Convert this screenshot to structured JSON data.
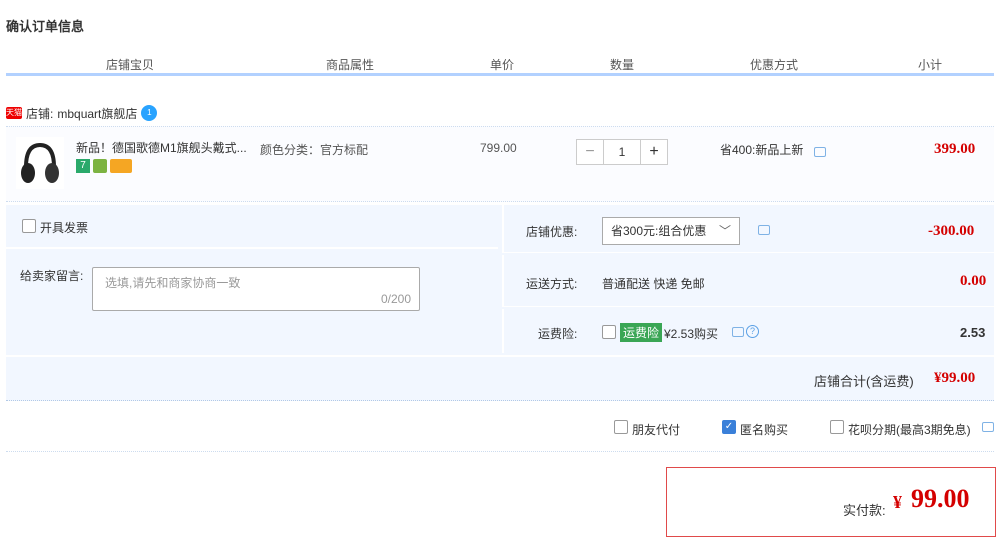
{
  "page_title": "确认订单信息",
  "table_headers": [
    "店铺宝贝",
    "商品属性",
    "单价",
    "数量",
    "优惠方式",
    "小计"
  ],
  "shop": {
    "badge": "天猫",
    "label": "店铺:",
    "name": "mbquart旗舰店",
    "ww_badge": "1"
  },
  "item": {
    "title": "新品！德国歌德M1旗舰头戴式...",
    "tag_number": "7",
    "attribute": "颜色分类：官方标配",
    "unit_price": "799.00",
    "quantity": "1",
    "minus": "−",
    "plus": "+",
    "promotion": "省400:新品上新",
    "subtotal": "399.00"
  },
  "invoice_label": "开具发票",
  "message": {
    "label": "给卖家留言:",
    "placeholder": "选填,请先和商家协商一致",
    "count": "0/200"
  },
  "shop_discount": {
    "label": "店铺优惠:",
    "selected": "省300元:组合优惠",
    "value": "-300.00"
  },
  "shipping": {
    "label": "运送方式:",
    "value_text": "普通配送 快递 免邮",
    "value": "0.00"
  },
  "insurance": {
    "label": "运费险:",
    "badge": "运费险",
    "text": "¥2.53购买",
    "value": "2.53"
  },
  "shop_total": {
    "label": "店铺合计(含运费)",
    "value": "¥99.00"
  },
  "options": {
    "friend_pay": "朋友代付",
    "anonymous": "匿名购买",
    "huabei": "花呗分期(最高3期免息)"
  },
  "payment": {
    "label": "实付款:",
    "symbol": "¥",
    "value": "99.00"
  },
  "icons": [
    "tmall-icon",
    "wangwang-icon",
    "message-icon",
    "help-icon",
    "chevron-down-icon",
    "check-icon"
  ],
  "colors": {
    "accent_red": "#d40000",
    "panel_bg": "#f2f7ff",
    "header_line": "#b2d1ff",
    "check_blue": "#3a80d9"
  }
}
